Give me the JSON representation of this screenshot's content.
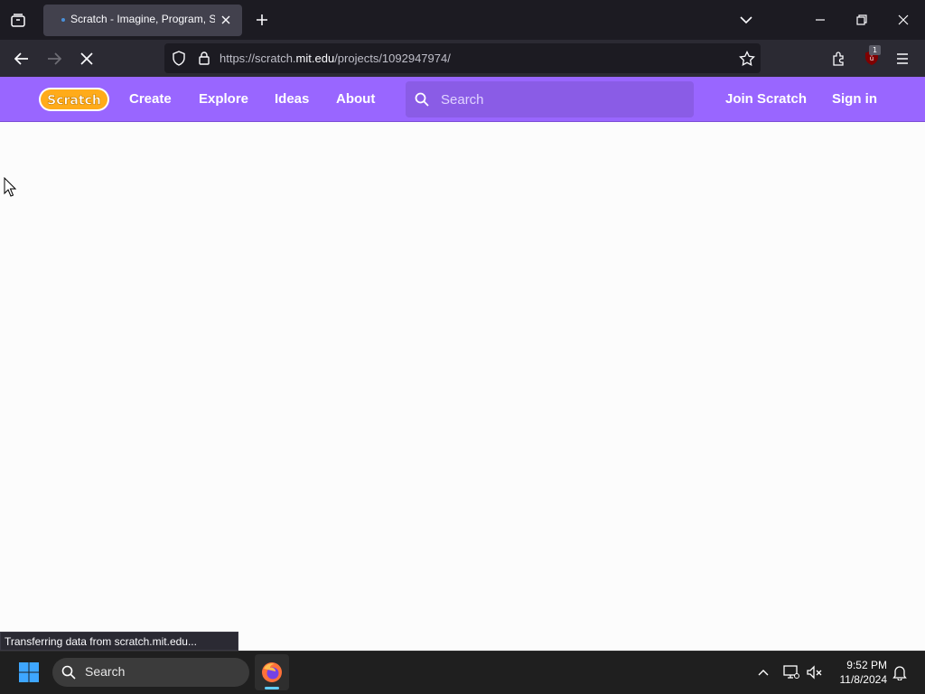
{
  "browser": {
    "tab_title": "Scratch - Imagine, Program, Share",
    "url_prefix": "https://scratch.",
    "url_host": "mit.edu",
    "url_path": "/projects/1092947974/",
    "ublock_count": "1",
    "status_text": "Transferring data from scratch.mit.edu..."
  },
  "scratch": {
    "logo_text": "Scratch",
    "nav": {
      "create": "Create",
      "explore": "Explore",
      "ideas": "Ideas",
      "about": "About",
      "join": "Join Scratch",
      "signin": "Sign in"
    },
    "search_placeholder": "Search"
  },
  "taskbar": {
    "search_label": "Search",
    "time": "9:52 PM",
    "date": "11/8/2024"
  },
  "colors": {
    "scratch_purple": "#9966ff",
    "browser_dark": "#1c1b22",
    "toolbar": "#2b2a33"
  }
}
